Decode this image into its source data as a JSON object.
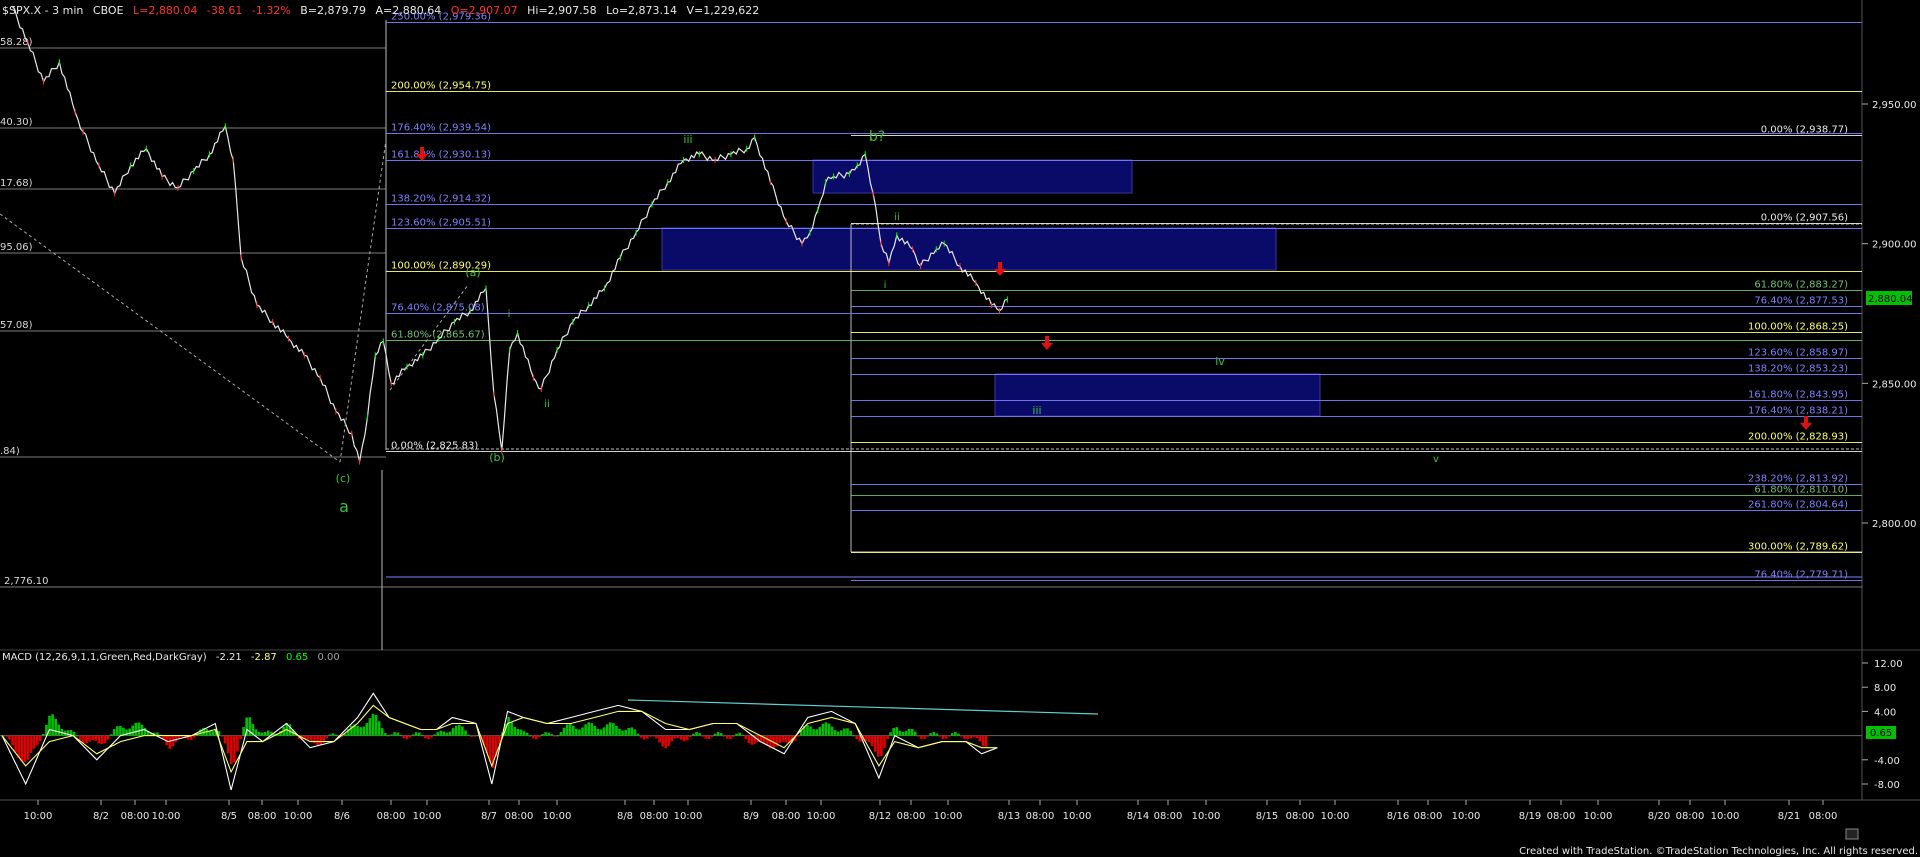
{
  "header": {
    "symbol": "$SPX.X - 3 min",
    "exchange": "CBOE",
    "last": "L=2,880.04",
    "change": "-38.61",
    "change_pct": "-1.32%",
    "bid": "B=2,879.79",
    "ask": "A=2,880.64",
    "open": "O=2,907.07",
    "high": "Hi=2,907.58",
    "low": "Lo=2,873.14",
    "volume": "V=1,229,622"
  },
  "last_price_label": "2,880.04",
  "macd_label": "MACD (12,26,9,1,1,Green,Red,DarkGray)",
  "macd_values": [
    "-2.21",
    "-2.87",
    "0.65",
    "0.00"
  ],
  "macd_last_label": "0.65",
  "footer": "Created with TradeStation. ©TradeStation Technologies, Inc. All rights reserved.",
  "colors": {
    "up_text": "#00ff00",
    "down_text": "#ff2020",
    "fib_blue": "#7f7fff",
    "fib_white": "#e8e8e8",
    "fib_yellow": "#ffff66",
    "fib_green": "#6fbf6f",
    "box_fill": "#0b0b6e",
    "wave_green": "#39c639",
    "arrow_red": "#e01010"
  },
  "chart_data": [
    {
      "type": "line",
      "series": [
        {
          "values": [
            [
              0,
              2985
            ],
            [
              2,
              2972
            ],
            [
              4,
              2958
            ],
            [
              6,
              2965
            ],
            [
              8,
              2947
            ],
            [
              9,
              2940
            ],
            [
              11,
              2928
            ],
            [
              13,
              2918
            ],
            [
              15,
              2928
            ],
            [
              17,
              2934
            ],
            [
              19,
              2924
            ],
            [
              21,
              2920
            ],
            [
              23,
              2926
            ],
            [
              25,
              2932
            ],
            [
              27,
              2942
            ],
            [
              28,
              2930
            ],
            [
              29,
              2895
            ],
            [
              31,
              2878
            ],
            [
              33,
              2872
            ],
            [
              35,
              2866
            ],
            [
              37,
              2860
            ],
            [
              39,
              2852
            ],
            [
              41,
              2840
            ],
            [
              43,
              2832
            ],
            [
              44,
              2822
            ],
            [
              45,
              2838
            ],
            [
              46,
              2860
            ],
            [
              47,
              2865
            ],
            [
              48,
              2850
            ],
            [
              50,
              2856
            ],
            [
              52,
              2860
            ],
            [
              54,
              2866
            ],
            [
              56,
              2872
            ],
            [
              58,
              2876
            ],
            [
              60,
              2884
            ],
            [
              61,
              2846
            ],
            [
              62,
              2826
            ],
            [
              63,
              2862
            ],
            [
              64,
              2868
            ],
            [
              66,
              2852
            ],
            [
              67,
              2848
            ],
            [
              69,
              2862
            ],
            [
              71,
              2872
            ],
            [
              73,
              2878
            ],
            [
              75,
              2884
            ],
            [
              77,
              2895
            ],
            [
              79,
              2904
            ],
            [
              81,
              2914
            ],
            [
              83,
              2922
            ],
            [
              85,
              2930
            ],
            [
              87,
              2932
            ],
            [
              89,
              2930
            ],
            [
              91,
              2932
            ],
            [
              93,
              2934
            ],
            [
              94,
              2938
            ],
            [
              96,
              2922
            ],
            [
              98,
              2908
            ],
            [
              100,
              2900
            ],
            [
              101,
              2904
            ],
            [
              102,
              2912
            ],
            [
              103,
              2922
            ],
            [
              104,
              2924
            ],
            [
              106,
              2925
            ],
            [
              107,
              2928
            ],
            [
              108,
              2932
            ],
            [
              109,
              2918
            ],
            [
              110,
              2900
            ],
            [
              111,
              2893
            ],
            [
              112,
              2903
            ],
            [
              114,
              2898
            ],
            [
              115,
              2892
            ],
            [
              117,
              2898
            ],
            [
              118,
              2900
            ],
            [
              120,
              2892
            ],
            [
              122,
              2886
            ],
            [
              124,
              2878
            ],
            [
              125,
              2876
            ],
            [
              126,
              2880
            ]
          ]
        }
      ],
      "y_tick_labels": [
        "2,950.00",
        "2,900.00",
        "2,850.00",
        "2,800.00"
      ],
      "left_cut_labels": [
        "58.28)",
        "40.30)",
        "17.68)",
        "95.06)",
        "57.08)",
        ".84)",
        "2,776.10"
      ],
      "fib_levels": [
        {
          "label": "250.00% (2,979.36)",
          "value": 2979.36,
          "color": "#7f7fff"
        },
        {
          "label": "200.00% (2,954.75)",
          "value": 2954.75,
          "color": "#ffff66"
        },
        {
          "label": "176.40% (2,939.54)",
          "value": 2939.54,
          "color": "#7f7fff"
        },
        {
          "label": "161.80% (2,930.13)",
          "value": 2930.13,
          "color": "#7f7fff"
        },
        {
          "label": "138.20% (2,914.32)",
          "value": 2914.32,
          "color": "#7f7fff"
        },
        {
          "label": "123.60% (2,905.51)",
          "value": 2905.51,
          "color": "#7f7fff"
        },
        {
          "label": "100.00% (2,890.29)",
          "value": 2890.29,
          "color": "#ffff66"
        },
        {
          "label": "76.40% (2,875.08)",
          "value": 2875.08,
          "color": "#7f7fff"
        },
        {
          "label": "61.80% (2,865.67)",
          "value": 2865.67,
          "color": "#6fbf6f"
        },
        {
          "label": "0.00% (2,825.83)",
          "value": 2825.83,
          "color": "#e8e8e8"
        },
        {
          "label": "0.00% (2,938.77)",
          "value": 2938.77,
          "color": "#e8e8e8"
        },
        {
          "label": "0.00% (2,907.56)",
          "value": 2907.56,
          "color": "#e8e8e8"
        },
        {
          "label": "61.80% (2,883.27)",
          "value": 2883.27,
          "color": "#6fbf6f"
        },
        {
          "label": "76.40% (2,877.53)",
          "value": 2877.53,
          "color": "#7f7fff"
        },
        {
          "label": "100.00% (2,868.25)",
          "value": 2868.25,
          "color": "#ffff66"
        },
        {
          "label": "123.60% (2,858.97)",
          "value": 2858.97,
          "color": "#7f7fff"
        },
        {
          "label": "138.20% (2,853.23)",
          "value": 2853.23,
          "color": "#7f7fff"
        },
        {
          "label": "161.80% (2,843.95)",
          "value": 2843.95,
          "color": "#7f7fff"
        },
        {
          "label": "176.40% (2,838.21)",
          "value": 2838.21,
          "color": "#7f7fff"
        },
        {
          "label": "200.00% (2,828.93)",
          "value": 2828.93,
          "color": "#ffff66"
        },
        {
          "label": "238.20% (2,813.92)",
          "value": 2813.92,
          "color": "#7f7fff"
        },
        {
          "label": "61.80% (2,810.10)",
          "value": 2810.1,
          "color": "#6fbf6f"
        },
        {
          "label": "261.80% (2,804.64)",
          "value": 2804.64,
          "color": "#7f7fff"
        },
        {
          "label": "300.00% (2,789.62)",
          "value": 2789.62,
          "color": "#ffff66"
        },
        {
          "label": "76.40% (2,779.71)",
          "value": 2779.71,
          "color": "#7f7fff"
        }
      ],
      "wave_labels": [
        "a",
        "(c)",
        "(a)",
        "(b)",
        "i",
        "ii",
        "iii",
        "b?",
        "i",
        "ii",
        "iii",
        "iv",
        "v"
      ],
      "x_tick_labels": [
        "10:00",
        "8/2",
        "08:00",
        "10:00",
        "8/5",
        "08:00",
        "10:00",
        "8/6",
        "08:00",
        "10:00",
        "8/7",
        "08:00",
        "10:00",
        "8/8",
        "08:00",
        "10:00",
        "8/9",
        "08:00",
        "10:00",
        "8/12",
        "08:00",
        "10:00",
        "8/13",
        "08:00",
        "10:00",
        "8/14",
        "08:00",
        "10:00",
        "8/15",
        "08:00",
        "10:00",
        "8/16",
        "08:00",
        "10:00",
        "8/19",
        "08:00",
        "10:00",
        "8/20",
        "08:00",
        "10:00",
        "8/21",
        "08:00"
      ]
    },
    {
      "type": "line",
      "series": [
        {
          "name": "MACD",
          "values": [
            [
              0,
              0
            ],
            [
              3,
              -8
            ],
            [
              6,
              1
            ],
            [
              9,
              0
            ],
            [
              12,
              -4
            ],
            [
              15,
              0
            ],
            [
              18,
              1
            ],
            [
              21,
              -1
            ],
            [
              24,
              0
            ],
            [
              27,
              2
            ],
            [
              29,
              -9
            ],
            [
              31,
              1
            ],
            [
              33,
              -1
            ],
            [
              36,
              2
            ],
            [
              39,
              -2
            ],
            [
              42,
              -1
            ],
            [
              45,
              3
            ],
            [
              47,
              7
            ],
            [
              49,
              3
            ],
            [
              51,
              2
            ],
            [
              53,
              1
            ],
            [
              55,
              1
            ],
            [
              57,
              3
            ],
            [
              60,
              2
            ],
            [
              62,
              -8
            ],
            [
              64,
              4
            ],
            [
              66,
              3
            ],
            [
              69,
              2
            ],
            [
              72,
              3
            ],
            [
              75,
              4
            ],
            [
              78,
              5
            ],
            [
              81,
              4
            ],
            [
              84,
              1
            ],
            [
              87,
              1
            ],
            [
              90,
              2
            ],
            [
              93,
              2
            ],
            [
              96,
              -1
            ],
            [
              99,
              -3
            ],
            [
              102,
              3
            ],
            [
              105,
              4
            ],
            [
              108,
              2
            ],
            [
              111,
              -7
            ],
            [
              113,
              0
            ],
            [
              116,
              -2
            ],
            [
              119,
              -1
            ],
            [
              122,
              -1
            ],
            [
              124,
              -3
            ],
            [
              126,
              -2
            ]
          ]
        },
        {
          "name": "Signal",
          "values": [
            [
              0,
              0
            ],
            [
              3,
              -5
            ],
            [
              6,
              -1
            ],
            [
              9,
              0
            ],
            [
              12,
              -3
            ],
            [
              15,
              -1
            ],
            [
              18,
              0
            ],
            [
              21,
              0
            ],
            [
              24,
              0
            ],
            [
              27,
              1
            ],
            [
              29,
              -6
            ],
            [
              31,
              -1
            ],
            [
              33,
              -1
            ],
            [
              36,
              1
            ],
            [
              39,
              -1
            ],
            [
              42,
              -1
            ],
            [
              45,
              2
            ],
            [
              47,
              5
            ],
            [
              49,
              3
            ],
            [
              51,
              2
            ],
            [
              53,
              1
            ],
            [
              55,
              1
            ],
            [
              57,
              2
            ],
            [
              60,
              2
            ],
            [
              62,
              -5
            ],
            [
              64,
              2
            ],
            [
              66,
              3
            ],
            [
              69,
              2
            ],
            [
              72,
              2
            ],
            [
              75,
              3
            ],
            [
              78,
              4
            ],
            [
              81,
              4
            ],
            [
              84,
              2
            ],
            [
              87,
              1
            ],
            [
              90,
              2
            ],
            [
              93,
              2
            ],
            [
              96,
              0
            ],
            [
              99,
              -2
            ],
            [
              102,
              2
            ],
            [
              105,
              3
            ],
            [
              108,
              2
            ],
            [
              111,
              -5
            ],
            [
              113,
              -1
            ],
            [
              116,
              -2
            ],
            [
              119,
              -1
            ],
            [
              122,
              -1
            ],
            [
              124,
              -2
            ],
            [
              126,
              -2
            ]
          ]
        }
      ],
      "y_tick_labels": [
        "12.00",
        "8.00",
        "4.00",
        "-4.00",
        "-8.00"
      ],
      "ylim": [
        -10,
        14
      ]
    }
  ]
}
